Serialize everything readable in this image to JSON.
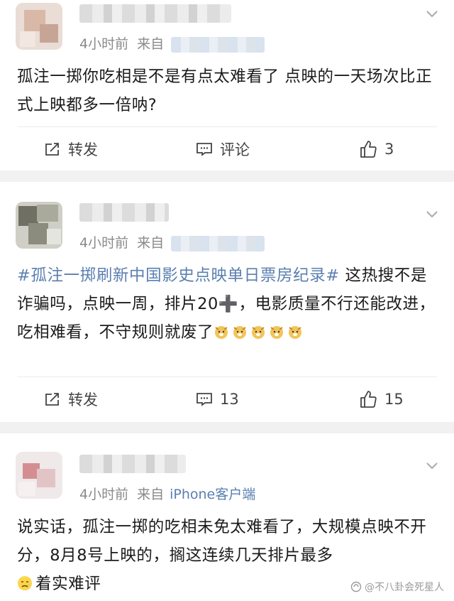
{
  "posts": [
    {
      "time": "4小时前",
      "from": "来自",
      "text": "孤注一掷你吃相是不是有点太难看了 点映的一天场次比正式上映都多一倍呐?",
      "actions": {
        "forward": "转发",
        "comment": "评论",
        "like": "3"
      }
    },
    {
      "time": "4小时前",
      "from": "来自",
      "hashtag": "#孤注一掷刷新中国影史点映单日票房纪录#",
      "text": " 这热搜不是诈骗吗，点映一周，排片20➕，电影质量不行还能改进，吃相难看，不守规则就废了",
      "actions": {
        "forward": "转发",
        "comment": "13",
        "like": "15"
      }
    },
    {
      "time": "4小时前",
      "from": "来自",
      "source": "iPhone客户端",
      "text": "说实话，孤注一掷的吃相未免太难看了，大规模点映不开分，8月8号上映的，搁这连续几天排片最多",
      "text2": "着实难评"
    }
  ],
  "watermark": "@不八卦会死星人",
  "colors": {
    "link": "#5a7fb0",
    "meta": "#8a8a8a",
    "bg": "#f1f1f1"
  },
  "icons": [
    "chevron-down-icon",
    "forward-icon",
    "comment-icon",
    "like-icon",
    "dog-emoji-icon",
    "sad-emoji-icon"
  ]
}
